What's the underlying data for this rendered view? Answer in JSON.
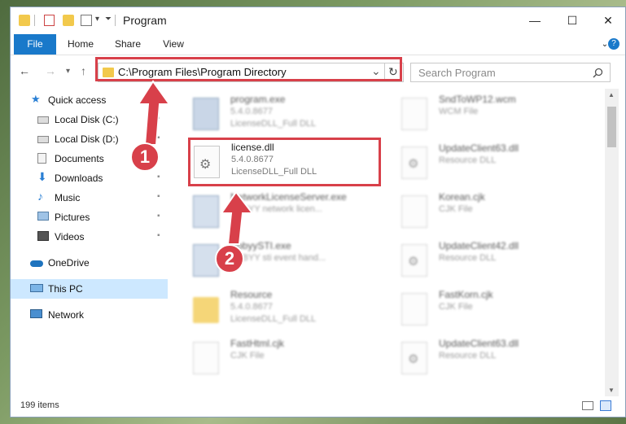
{
  "window": {
    "title": "Program",
    "minimize": "—",
    "maximize": "☐",
    "close": "✕"
  },
  "ribbon": {
    "tabs": [
      "File",
      "Home",
      "Share",
      "View"
    ],
    "help": "?"
  },
  "navbar": {
    "back": "←",
    "forward": "→",
    "recent": "▾",
    "up": "↑",
    "address": "C:\\Program Files\\Program Directory",
    "address_dropdown": "⌄",
    "refresh": "↻",
    "search_placeholder": "Search Program"
  },
  "sidebar": {
    "items": [
      {
        "label": "Quick access",
        "icon": "star-icon",
        "pinned": false
      },
      {
        "label": "Local Disk (C:)",
        "icon": "drive-icon",
        "pinned": true
      },
      {
        "label": "Local Disk (D:)",
        "icon": "drive-icon",
        "pinned": true
      },
      {
        "label": "Documents",
        "icon": "documents-icon",
        "pinned": true
      },
      {
        "label": "Downloads",
        "icon": "download-icon",
        "pinned": true
      },
      {
        "label": "Music",
        "icon": "music-icon",
        "pinned": true
      },
      {
        "label": "Pictures",
        "icon": "pictures-icon",
        "pinned": true
      },
      {
        "label": "Videos",
        "icon": "videos-icon",
        "pinned": true
      },
      {
        "label": "OneDrive",
        "icon": "cloud-icon",
        "pinned": false
      },
      {
        "label": "This PC",
        "icon": "computer-icon",
        "pinned": false,
        "selected": true
      },
      {
        "label": "Network",
        "icon": "network-icon",
        "pinned": false
      }
    ],
    "pin_glyph": "📌"
  },
  "files": {
    "left": [
      {
        "name": "program.exe",
        "line2": "5.4.0.8677",
        "line3": "LicenseDLL_Full DLL",
        "icon": "exe-icon"
      },
      {
        "name": "license.dll",
        "line2": "5.4.0.8677",
        "line3": "LicenseDLL_Full DLL",
        "icon": "dll-gear-icon"
      },
      {
        "name": "NetworkLicenseServer.exe",
        "line2": "ABBYY network licen...",
        "line3": "",
        "icon": "exe-icon"
      },
      {
        "name": "AbbyySTI.exe",
        "line2": "ABBYY sti event hand...",
        "line3": "",
        "icon": "exe-icon"
      },
      {
        "name": "Resource",
        "line2": "5.4.0.8677",
        "line3": "LicenseDLL_Full DLL",
        "icon": "folder-icon"
      },
      {
        "name": "FastHtml.cjk",
        "line2": "CJK File",
        "line3": "",
        "icon": "file-icon"
      }
    ],
    "right": [
      {
        "name": "SndToWP12.wcm",
        "line2": "WCM File",
        "line3": "",
        "icon": "file-icon"
      },
      {
        "name": "UpdateClient63.dll",
        "line2": "Resource DLL",
        "line3": "",
        "icon": "dll-gear-icon"
      },
      {
        "name": "Korean.cjk",
        "line2": "CJK File",
        "line3": "",
        "icon": "file-icon"
      },
      {
        "name": "UpdateClient42.dll",
        "line2": "Resource DLL",
        "line3": "",
        "icon": "dll-gear-icon"
      },
      {
        "name": "FastKorn.cjk",
        "line2": "CJK File",
        "line3": "",
        "icon": "file-icon"
      },
      {
        "name": "UpdateClient63.dll",
        "line2": "Resource DLL",
        "line3": "",
        "icon": "dll-gear-icon"
      }
    ]
  },
  "status": {
    "items_count": "199 items"
  },
  "annotations": {
    "step1": "1",
    "step2": "2",
    "color": "#d8404a"
  }
}
